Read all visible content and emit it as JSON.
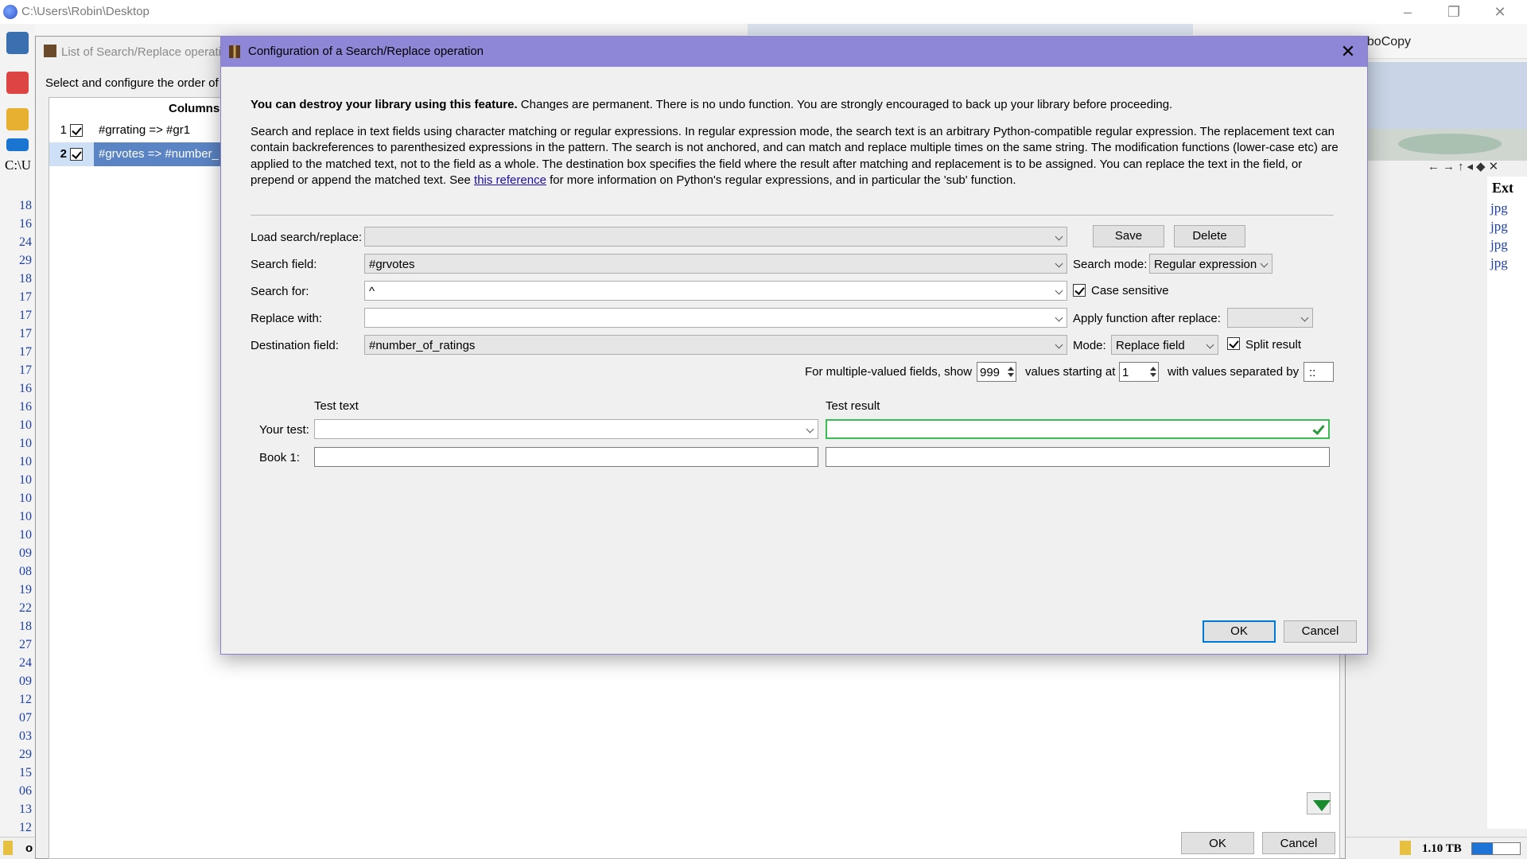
{
  "window": {
    "title": "C:\\Users\\Robin\\Desktop"
  },
  "background": {
    "topright_text": "oboCopy",
    "path_fragment": "C:\\U",
    "ext_header": "Ext",
    "ext_values": [
      "jpg",
      "jpg",
      "jpg",
      "jpg"
    ],
    "row_numbers": [
      "18",
      "16",
      "24",
      "29",
      "18",
      "17",
      "17",
      "17",
      "17",
      "17",
      "16",
      "16",
      "10",
      "10",
      "10",
      "10",
      "10",
      "10",
      "10",
      "09",
      "08",
      "19",
      "22",
      "18",
      "27",
      "24",
      "09",
      "12",
      "07",
      "03",
      "29",
      "15",
      "06",
      "13",
      "12"
    ],
    "status_size": "1.10 TB",
    "status_left": "o"
  },
  "list_dialog": {
    "title": "List of Search/Replace operati",
    "intro": "Select and configure the order of",
    "column_header": "Columns",
    "rows": [
      {
        "num": "1",
        "text": "#grrating => #gr1"
      },
      {
        "num": "2",
        "text": "#grvotes => #number_"
      }
    ],
    "ok_label": "OK",
    "cancel_label": "Cancel"
  },
  "config_dialog": {
    "title": "Configuration of a Search/Replace operation",
    "warning_bold": "You can destroy your library using this feature.",
    "warning_rest": " Changes are permanent. There is no undo function. You are strongly encouraged to back up your library before proceeding.",
    "desc_before_link": "Search and replace in text fields using character matching or regular expressions. In regular expression mode, the search text is an arbitrary Python-compatible regular expression. The replacement text can contain backreferences to parenthesized expressions in the pattern. The search is not anchored, and can match and replace multiple times on the same string. The modification functions (lower-case etc) are applied to the matched text, not to the field as a whole. The destination box specifies the field where the result after matching and replacement is to be assigned. You can replace the text in the field, or prepend or append the matched text. See ",
    "desc_link": "this reference",
    "desc_after_link": " for more information on Python's regular expressions, and in particular the 'sub' function.",
    "load_label": "Load search/replace:",
    "load_value": "",
    "save_label": "Save",
    "delete_label": "Delete",
    "search_field_label": "Search field:",
    "search_field_value": "#grvotes",
    "search_mode_label": "Search mode:",
    "search_mode_value": "Regular expression",
    "search_for_label": "Search for:",
    "search_for_value": "^",
    "case_sensitive_label": "Case sensitive",
    "replace_with_label": "Replace with:",
    "replace_with_value": "",
    "apply_function_label": "Apply function after replace:",
    "apply_function_value": "",
    "destination_label": "Destination field:",
    "destination_value": "#number_of_ratings",
    "mode_label": "Mode:",
    "mode_value": "Replace field",
    "split_result_label": "Split result",
    "multi_show_label": "For multiple-valued fields, show",
    "multi_show_value": "999",
    "starting_at_label": "values starting at",
    "starting_at_value": "1",
    "separated_by_label": "with values separated by",
    "separator_value": "::",
    "test_text_header": "Test text",
    "test_result_header": "Test result",
    "your_test_label": "Your test:",
    "book1_label": "Book 1:",
    "ok_label": "OK",
    "cancel_label": "Cancel"
  }
}
